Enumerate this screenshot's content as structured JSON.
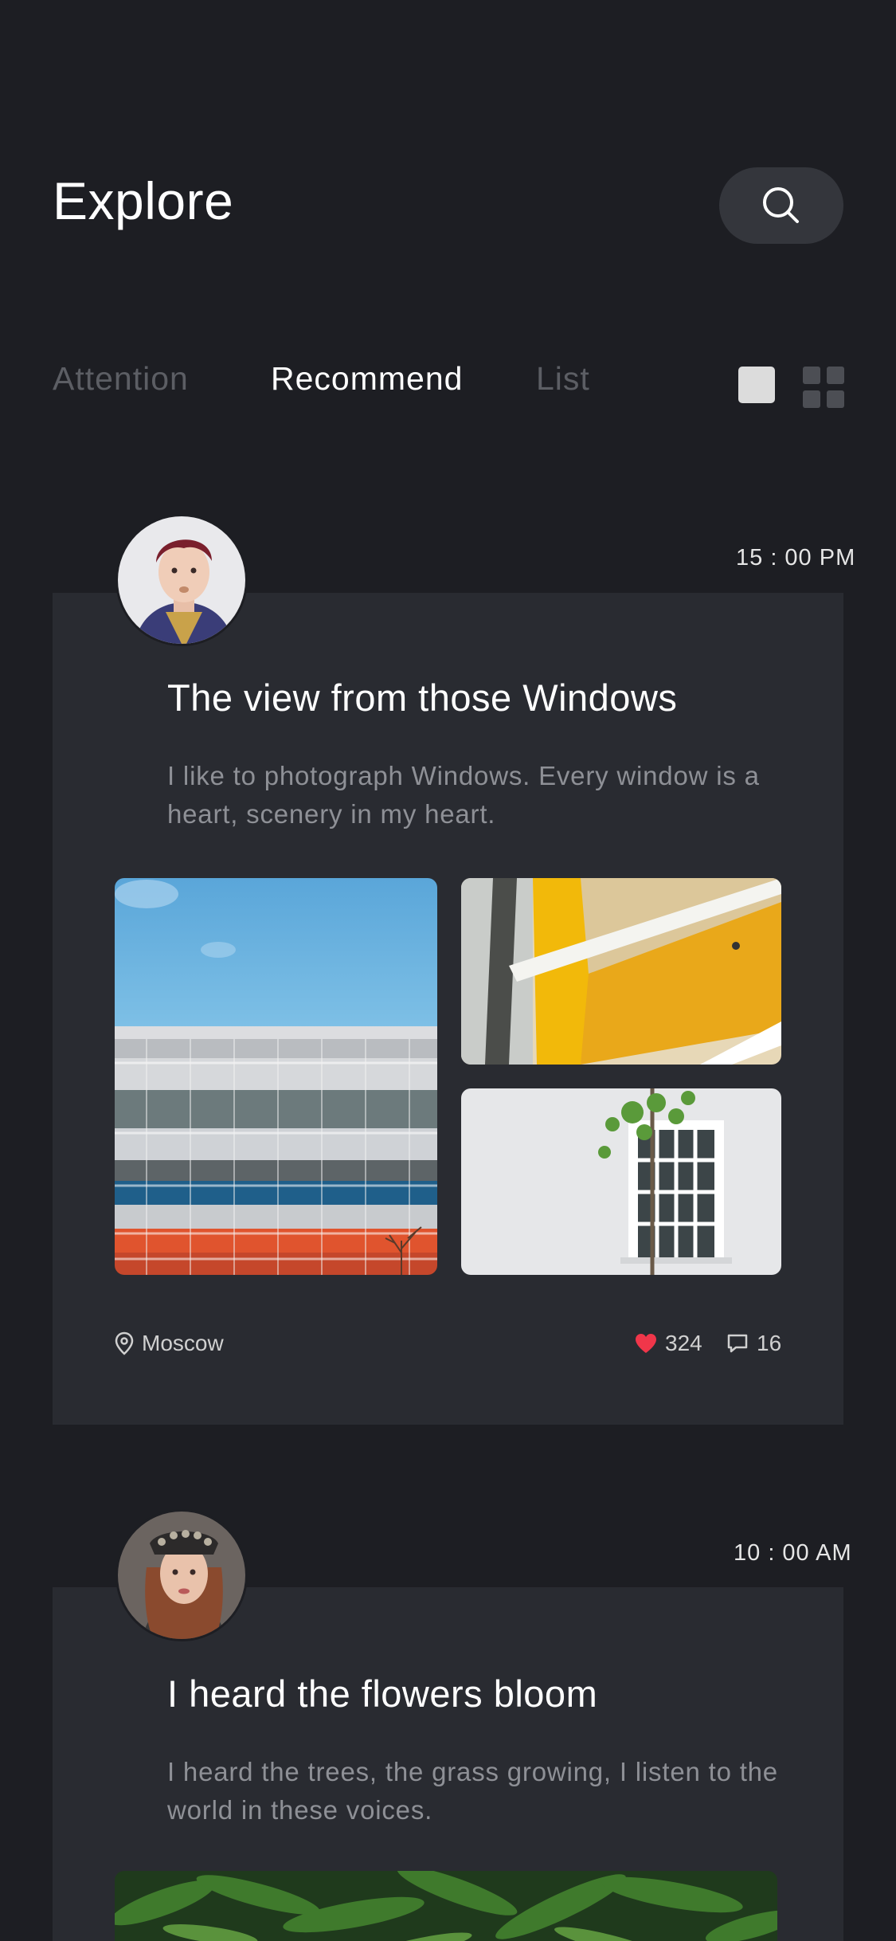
{
  "header": {
    "title": "Explore",
    "search_icon": "search-icon"
  },
  "tabs": [
    {
      "label": "Attention",
      "active": false
    },
    {
      "label": "Recommend",
      "active": true
    },
    {
      "label": "List",
      "active": false
    }
  ],
  "view_toggle": {
    "single_icon": "single-view-icon",
    "grid_icon": "grid-view-icon",
    "selected": "single"
  },
  "posts": [
    {
      "time": "15 : 00 PM",
      "title": "The view from those Windows",
      "body": "I like to photograph Windows. Every window is a heart, scenery in my heart.",
      "location": "Moscow",
      "likes": "324",
      "comments": "16"
    },
    {
      "time": "10 : 00 AM",
      "title": "I heard the flowers bloom",
      "body": "I heard the trees, the grass growing, I listen to the world in these voices."
    }
  ],
  "colors": {
    "background": "#1d1e23",
    "card": "#292b31",
    "search_button": "#34363c",
    "heart": "#f0364a",
    "muted_text": "#8e9096"
  }
}
